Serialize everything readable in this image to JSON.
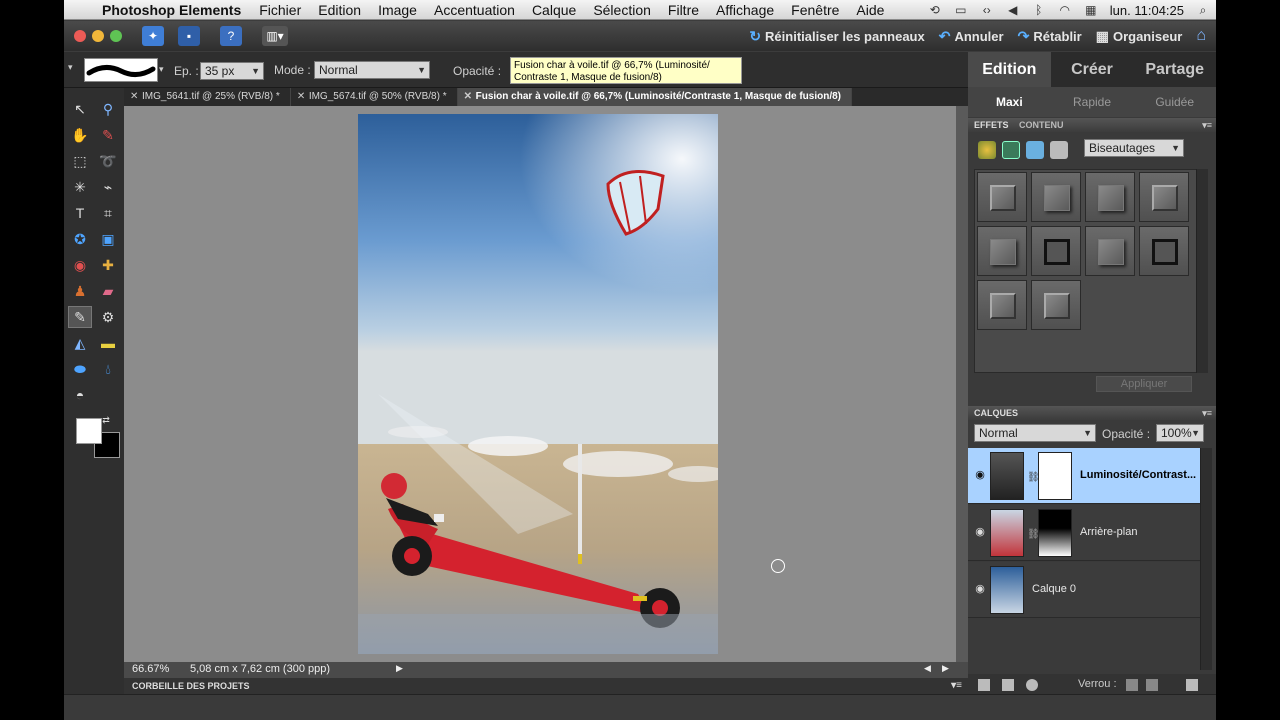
{
  "menubar": {
    "app_name": "Photoshop Elements",
    "menus": [
      "Fichier",
      "Edition",
      "Image",
      "Accentuation",
      "Calque",
      "Sélection",
      "Filtre",
      "Affichage",
      "Fenêtre",
      "Aide"
    ],
    "clock": "lun. 11:04:25"
  },
  "appbar": {
    "reset_panels": "Réinitialiser les panneaux",
    "undo": "Annuler",
    "redo": "Rétablir",
    "organizer": "Organiseur"
  },
  "options": {
    "size_label": "Ep. :",
    "size_value": "35 px",
    "mode_label": "Mode :",
    "mode_value": "Normal",
    "opacity_label": "Opacité :"
  },
  "tooltip": {
    "line1": "Fusion char à voile.tif @ 66,7% (Luminosité/",
    "line2": "Contraste 1, Masque de fusion/8)"
  },
  "doc_tabs": [
    {
      "label": "IMG_5641.tif @ 25% (RVB/8) *"
    },
    {
      "label": "IMG_5674.tif @ 50% (RVB/8) *"
    },
    {
      "label": "Fusion char à voile.tif @ 66,7% (Luminosité/Contraste 1, Masque de fusion/8)"
    }
  ],
  "status": {
    "zoom": "66.67%",
    "doc_info": "5,08 cm x 7,62 cm (300 ppp)"
  },
  "project_bin": "CORBEILLE DES PROJETS",
  "right_panel": {
    "mode_tabs": [
      "Edition",
      "Créer",
      "Partage"
    ],
    "sub_tabs": [
      "Maxi",
      "Rapide",
      "Guidée"
    ],
    "effects": {
      "header": "EFFETS",
      "subheader": "CONTENU",
      "category": "Biseautages",
      "apply_label": "Appliquer"
    },
    "layers": {
      "header": "CALQUES",
      "blend_mode": "Normal",
      "opacity_label": "Opacité :",
      "opacity_value": "100%",
      "items": [
        {
          "name": "Luminosité/Contrast..."
        },
        {
          "name": "Arrière-plan"
        },
        {
          "name": "Calque 0"
        }
      ],
      "lock_label": "Verrou :"
    }
  },
  "colors": {
    "selected_layer": "#a9d2ff",
    "accent_blue": "#5ab0ff",
    "tooltip_bg": "#ffffc6"
  }
}
